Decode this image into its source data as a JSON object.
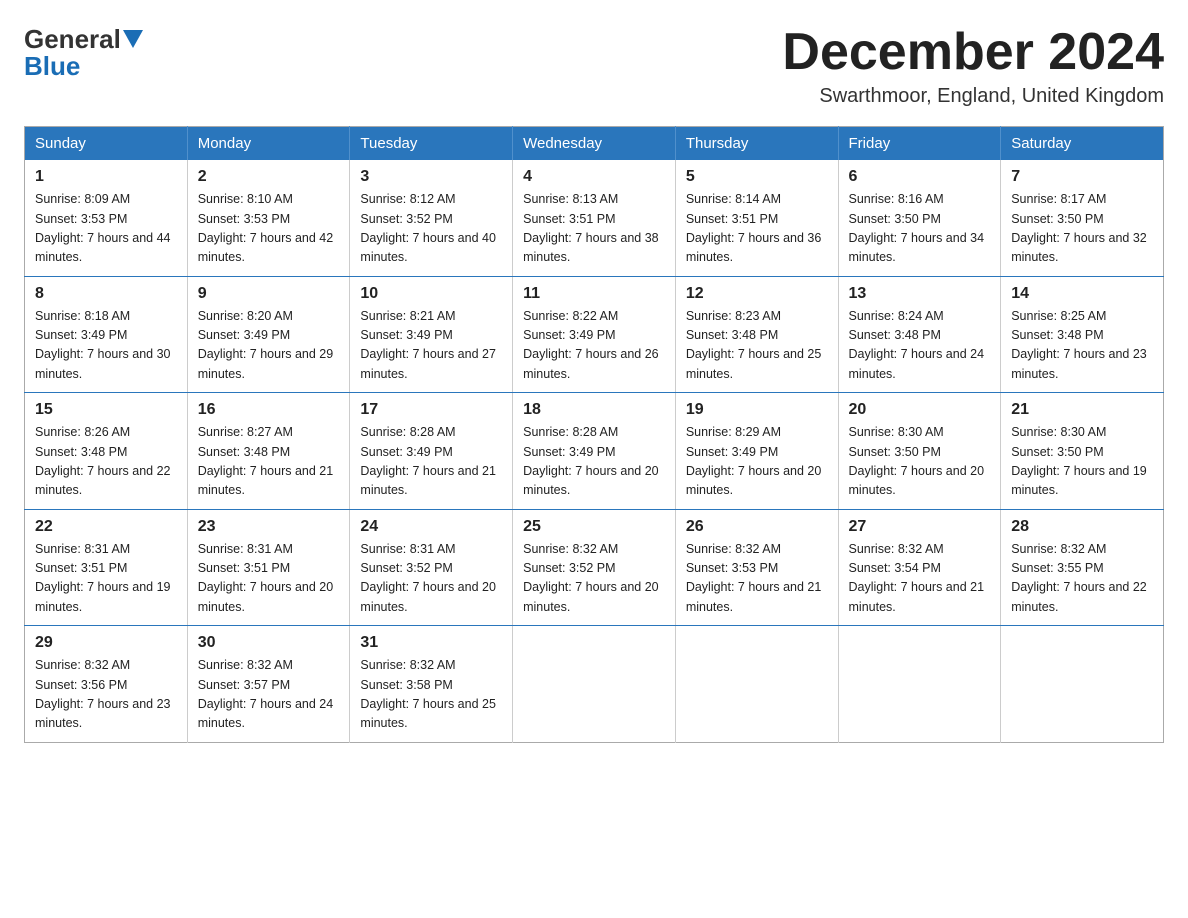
{
  "logo": {
    "general": "General",
    "blue": "Blue"
  },
  "title": "December 2024",
  "location": "Swarthmoor, England, United Kingdom",
  "days_of_week": [
    "Sunday",
    "Monday",
    "Tuesday",
    "Wednesday",
    "Thursday",
    "Friday",
    "Saturday"
  ],
  "weeks": [
    [
      {
        "day": "1",
        "sunrise": "8:09 AM",
        "sunset": "3:53 PM",
        "daylight": "7 hours and 44 minutes."
      },
      {
        "day": "2",
        "sunrise": "8:10 AM",
        "sunset": "3:53 PM",
        "daylight": "7 hours and 42 minutes."
      },
      {
        "day": "3",
        "sunrise": "8:12 AM",
        "sunset": "3:52 PM",
        "daylight": "7 hours and 40 minutes."
      },
      {
        "day": "4",
        "sunrise": "8:13 AM",
        "sunset": "3:51 PM",
        "daylight": "7 hours and 38 minutes."
      },
      {
        "day": "5",
        "sunrise": "8:14 AM",
        "sunset": "3:51 PM",
        "daylight": "7 hours and 36 minutes."
      },
      {
        "day": "6",
        "sunrise": "8:16 AM",
        "sunset": "3:50 PM",
        "daylight": "7 hours and 34 minutes."
      },
      {
        "day": "7",
        "sunrise": "8:17 AM",
        "sunset": "3:50 PM",
        "daylight": "7 hours and 32 minutes."
      }
    ],
    [
      {
        "day": "8",
        "sunrise": "8:18 AM",
        "sunset": "3:49 PM",
        "daylight": "7 hours and 30 minutes."
      },
      {
        "day": "9",
        "sunrise": "8:20 AM",
        "sunset": "3:49 PM",
        "daylight": "7 hours and 29 minutes."
      },
      {
        "day": "10",
        "sunrise": "8:21 AM",
        "sunset": "3:49 PM",
        "daylight": "7 hours and 27 minutes."
      },
      {
        "day": "11",
        "sunrise": "8:22 AM",
        "sunset": "3:49 PM",
        "daylight": "7 hours and 26 minutes."
      },
      {
        "day": "12",
        "sunrise": "8:23 AM",
        "sunset": "3:48 PM",
        "daylight": "7 hours and 25 minutes."
      },
      {
        "day": "13",
        "sunrise": "8:24 AM",
        "sunset": "3:48 PM",
        "daylight": "7 hours and 24 minutes."
      },
      {
        "day": "14",
        "sunrise": "8:25 AM",
        "sunset": "3:48 PM",
        "daylight": "7 hours and 23 minutes."
      }
    ],
    [
      {
        "day": "15",
        "sunrise": "8:26 AM",
        "sunset": "3:48 PM",
        "daylight": "7 hours and 22 minutes."
      },
      {
        "day": "16",
        "sunrise": "8:27 AM",
        "sunset": "3:48 PM",
        "daylight": "7 hours and 21 minutes."
      },
      {
        "day": "17",
        "sunrise": "8:28 AM",
        "sunset": "3:49 PM",
        "daylight": "7 hours and 21 minutes."
      },
      {
        "day": "18",
        "sunrise": "8:28 AM",
        "sunset": "3:49 PM",
        "daylight": "7 hours and 20 minutes."
      },
      {
        "day": "19",
        "sunrise": "8:29 AM",
        "sunset": "3:49 PM",
        "daylight": "7 hours and 20 minutes."
      },
      {
        "day": "20",
        "sunrise": "8:30 AM",
        "sunset": "3:50 PM",
        "daylight": "7 hours and 20 minutes."
      },
      {
        "day": "21",
        "sunrise": "8:30 AM",
        "sunset": "3:50 PM",
        "daylight": "7 hours and 19 minutes."
      }
    ],
    [
      {
        "day": "22",
        "sunrise": "8:31 AM",
        "sunset": "3:51 PM",
        "daylight": "7 hours and 19 minutes."
      },
      {
        "day": "23",
        "sunrise": "8:31 AM",
        "sunset": "3:51 PM",
        "daylight": "7 hours and 20 minutes."
      },
      {
        "day": "24",
        "sunrise": "8:31 AM",
        "sunset": "3:52 PM",
        "daylight": "7 hours and 20 minutes."
      },
      {
        "day": "25",
        "sunrise": "8:32 AM",
        "sunset": "3:52 PM",
        "daylight": "7 hours and 20 minutes."
      },
      {
        "day": "26",
        "sunrise": "8:32 AM",
        "sunset": "3:53 PM",
        "daylight": "7 hours and 21 minutes."
      },
      {
        "day": "27",
        "sunrise": "8:32 AM",
        "sunset": "3:54 PM",
        "daylight": "7 hours and 21 minutes."
      },
      {
        "day": "28",
        "sunrise": "8:32 AM",
        "sunset": "3:55 PM",
        "daylight": "7 hours and 22 minutes."
      }
    ],
    [
      {
        "day": "29",
        "sunrise": "8:32 AM",
        "sunset": "3:56 PM",
        "daylight": "7 hours and 23 minutes."
      },
      {
        "day": "30",
        "sunrise": "8:32 AM",
        "sunset": "3:57 PM",
        "daylight": "7 hours and 24 minutes."
      },
      {
        "day": "31",
        "sunrise": "8:32 AM",
        "sunset": "3:58 PM",
        "daylight": "7 hours and 25 minutes."
      },
      null,
      null,
      null,
      null
    ]
  ]
}
